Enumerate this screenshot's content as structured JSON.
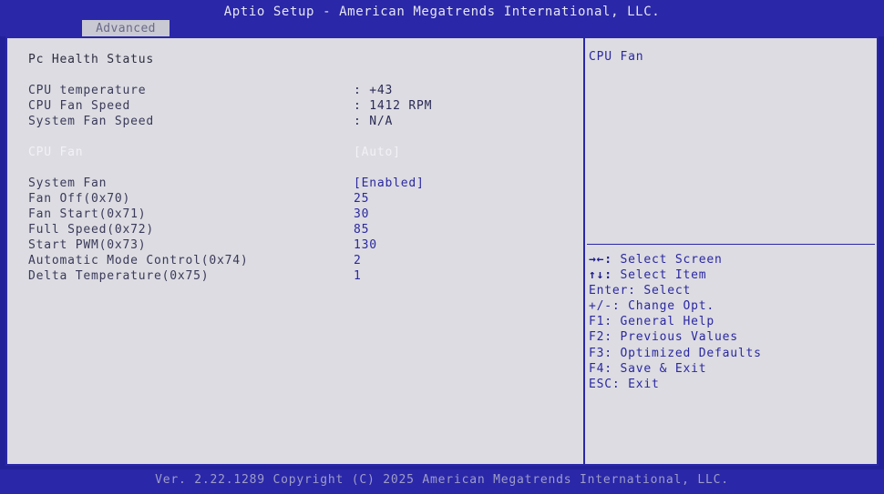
{
  "header": {
    "title": "Aptio Setup - American Megatrends International, LLC.",
    "tab_label": "Advanced"
  },
  "section_title": "Pc Health Status",
  "status": [
    {
      "label": "CPU temperature",
      "value": ": +43"
    },
    {
      "label": "CPU Fan Speed",
      "value": ": 1412 RPM"
    },
    {
      "label": "System Fan Speed",
      "value": ": N/A"
    }
  ],
  "cpu_fan": {
    "label": "CPU Fan",
    "value": "[Auto]"
  },
  "system_fan": {
    "label": "System Fan",
    "value": "[Enabled]"
  },
  "fan_settings": [
    {
      "label": "Fan Off(0x70)",
      "value": "25"
    },
    {
      "label": "Fan Start(0x71)",
      "value": "30"
    },
    {
      "label": "Full Speed(0x72)",
      "value": "85"
    },
    {
      "label": "Start PWM(0x73)",
      "value": "130"
    },
    {
      "label": "Automatic Mode Control(0x74)",
      "value": "2"
    },
    {
      "label": "Delta Temperature(0x75)",
      "value": "1"
    }
  ],
  "help_title": "CPU Fan",
  "key_help": [
    {
      "key": "→←:",
      "action": " Select Screen"
    },
    {
      "key": "↑↓:",
      "action": " Select Item"
    },
    {
      "key": "Enter:",
      "action": " Select"
    },
    {
      "key": "+/-:",
      "action": " Change Opt."
    },
    {
      "key": "F1:",
      "action": " General Help"
    },
    {
      "key": "F2:",
      "action": " Previous Values"
    },
    {
      "key": "F3:",
      "action": " Optimized Defaults"
    },
    {
      "key": "F4:",
      "action": " Save & Exit"
    },
    {
      "key": "ESC:",
      "action": " Exit"
    }
  ],
  "footer": "Ver. 2.22.1289 Copyright (C) 2025 American Megatrends International, LLC.",
  "colors": {
    "frame_blue": "#2a27a8",
    "panel_gray": "#dcdce2",
    "highlight_white": "#f2f2f6"
  }
}
